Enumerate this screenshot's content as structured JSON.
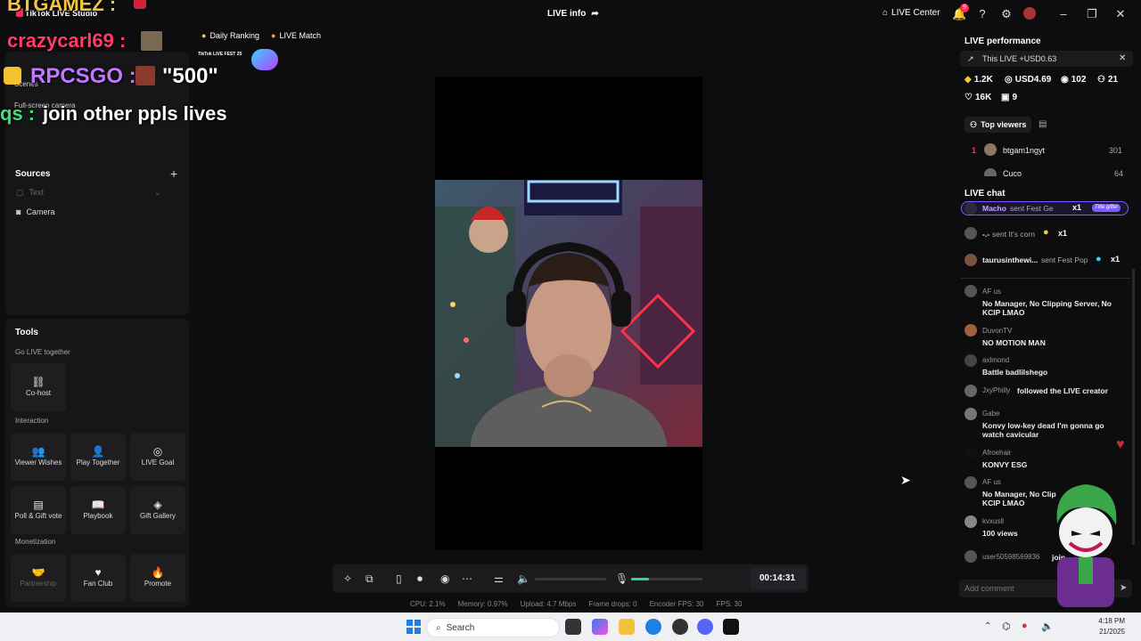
{
  "window": {
    "app_title": "TikTok LIVE Studio",
    "center_title": "LIVE info",
    "live_center": "LIVE Center",
    "notif_count": "9"
  },
  "overlay": {
    "channel": "BTGAMEZ :",
    "chat_line1_user": "crazycarl69 :",
    "chat_line2_user": "RPCSGO :",
    "chat_line2_text": "\"500\"",
    "chat_line3_user": "qs :",
    "chat_line3_text": "join other ppls lives"
  },
  "top_tags": {
    "daily_ranking": "Daily Ranking",
    "live_match": "LIVE Match",
    "fest_badge": "TikTok LIVE FEST 25"
  },
  "scenes": {
    "title": "Scenes",
    "scene_item": "Full-screen camera",
    "sources_title": "Sources",
    "sources": [
      {
        "label": "Text",
        "icon": "text-icon",
        "enabled": false
      },
      {
        "label": "Camera",
        "icon": "camera-icon",
        "enabled": true
      }
    ]
  },
  "tools": {
    "title": "Tools",
    "go_live_together": "Go LIVE together",
    "cohost": "Co-host",
    "interaction": "Interaction",
    "interaction_items": [
      "Viewer Wishes",
      "Play Together",
      "LIVE Goal",
      "Poll & Gift vote",
      "Playbook",
      "Gift Gallery"
    ],
    "monetization": "Monetization",
    "monetization_items": [
      "Partnership",
      "Fan Club",
      "Promote"
    ]
  },
  "controls": {
    "timer": "00:14:31",
    "volume_level": 0.0,
    "mic_level": 0.25
  },
  "stats": {
    "cpu": "CPU:  2.1%",
    "memory": "Memory:  0.97%",
    "upload": "Upload:  4.7 Mbps",
    "frame_drops": "Frame drops:  0",
    "encoder_fps": "Encoder FPS:  30",
    "fps": "FPS:  30"
  },
  "performance": {
    "title": "LIVE performance",
    "this_live": "This LIVE +USD0.63",
    "diamonds": "1.2K",
    "usd": "USD4.69",
    "viewers": "102",
    "new_followers": "21",
    "likes": "16K",
    "gifters": "9"
  },
  "top_viewers": {
    "title": "Top viewers",
    "rows": [
      {
        "rank": "1",
        "name": "btgam1ngyt",
        "score": "301"
      },
      {
        "rank": "",
        "name": "Cuco",
        "score": "64"
      }
    ]
  },
  "live_chat": {
    "title": "LIVE chat",
    "gifts": [
      {
        "name": "Macho",
        "text": "sent Fest Ge",
        "count": "x1",
        "badge": "Title gifter"
      },
      {
        "name": "-.-",
        "text": "sent It's corn",
        "count": "x1",
        "badge": ""
      },
      {
        "name": "taurusinthewi...",
        "text": "sent Fest Pop",
        "count": "x1",
        "badge": ""
      }
    ],
    "messages": [
      {
        "name": "AF us",
        "text": "No Manager, No Clipping Server, No KCIP LMAO"
      },
      {
        "name": "DuvonTV",
        "text": "NO MOTION MAN"
      },
      {
        "name": "axlmond",
        "text": "Battle badlilshego"
      },
      {
        "name": "JxyPhilly",
        "text": "followed the LIVE creator",
        "inline": true
      },
      {
        "name": "Gabe",
        "text": "Konvy low-key dead I'm gonna go watch cavicular"
      },
      {
        "name": "Afroehair",
        "text": "KONVY ESG"
      },
      {
        "name": "AF us",
        "text": "No Manager, No Clip KCIP LMAO"
      },
      {
        "name": "kvxusll",
        "text": "100 views"
      },
      {
        "name": "user50598569836",
        "text": "join",
        "inline": true
      }
    ],
    "comment_placeholder": "Add comment"
  },
  "taskbar": {
    "search": "Search",
    "time": "4:18 PM",
    "date": "21/2025"
  },
  "colors": {
    "accent": "#fe2c55",
    "panel": "#161618",
    "mic_green": "#25d9a0",
    "gifter_badge": "#7b5cff"
  }
}
